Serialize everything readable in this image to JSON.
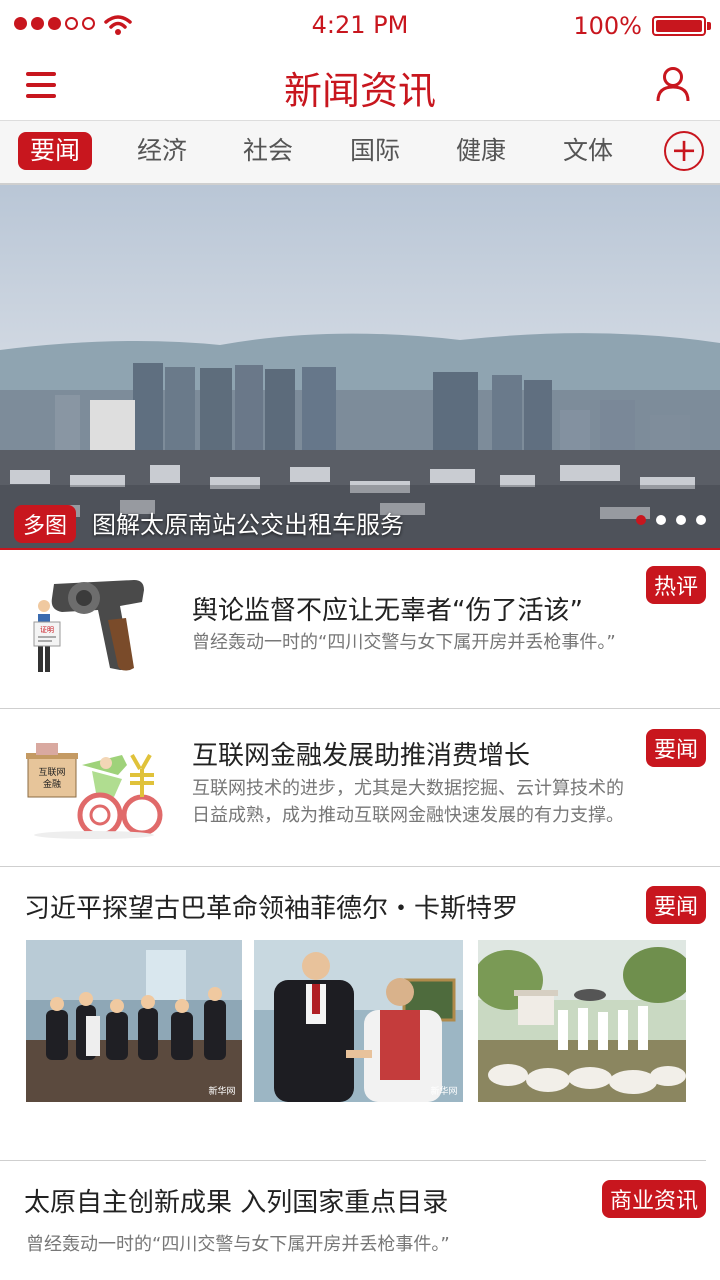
{
  "status": {
    "time": "4:21 PM",
    "battery": "100%"
  },
  "header": {
    "title": "新闻资讯"
  },
  "tabs": [
    {
      "label": "要闻"
    },
    {
      "label": "经济"
    },
    {
      "label": "社会"
    },
    {
      "label": "国际"
    },
    {
      "label": "健康"
    },
    {
      "label": "文体"
    }
  ],
  "hero": {
    "badge": "多图",
    "caption": "图解太原南站公交出租车服务",
    "slides": 4,
    "current": 1
  },
  "news": [
    {
      "title": "舆论监督不应让无辜者“伤了活该”",
      "desc": "曾经轰动一时的“四川交警与女下属开房并丢枪事件。”",
      "tag": "热评",
      "thumb_text": "证明"
    },
    {
      "title": "互联网金融发展助推消费增长",
      "desc1": "互联网技术的进步，尤其是大数据挖掘、云计算技术的",
      "desc2": "日益成熟，成为推动互联网金融快速发展的有力支撑。",
      "tag": "要闻",
      "thumb_text": "互联网金融"
    },
    {
      "title": "习近平探望古巴革命领袖菲德尔・卡斯特罗",
      "tag": "要闻",
      "watermark": "新华网"
    },
    {
      "title": "太原自主创新成果 入列国家重点目录",
      "desc": "曾经轰动一时的“四川交警与女下属开房并丢枪事件。”",
      "tag": "商业资讯"
    }
  ],
  "colors": {
    "accent": "#c8161e"
  }
}
